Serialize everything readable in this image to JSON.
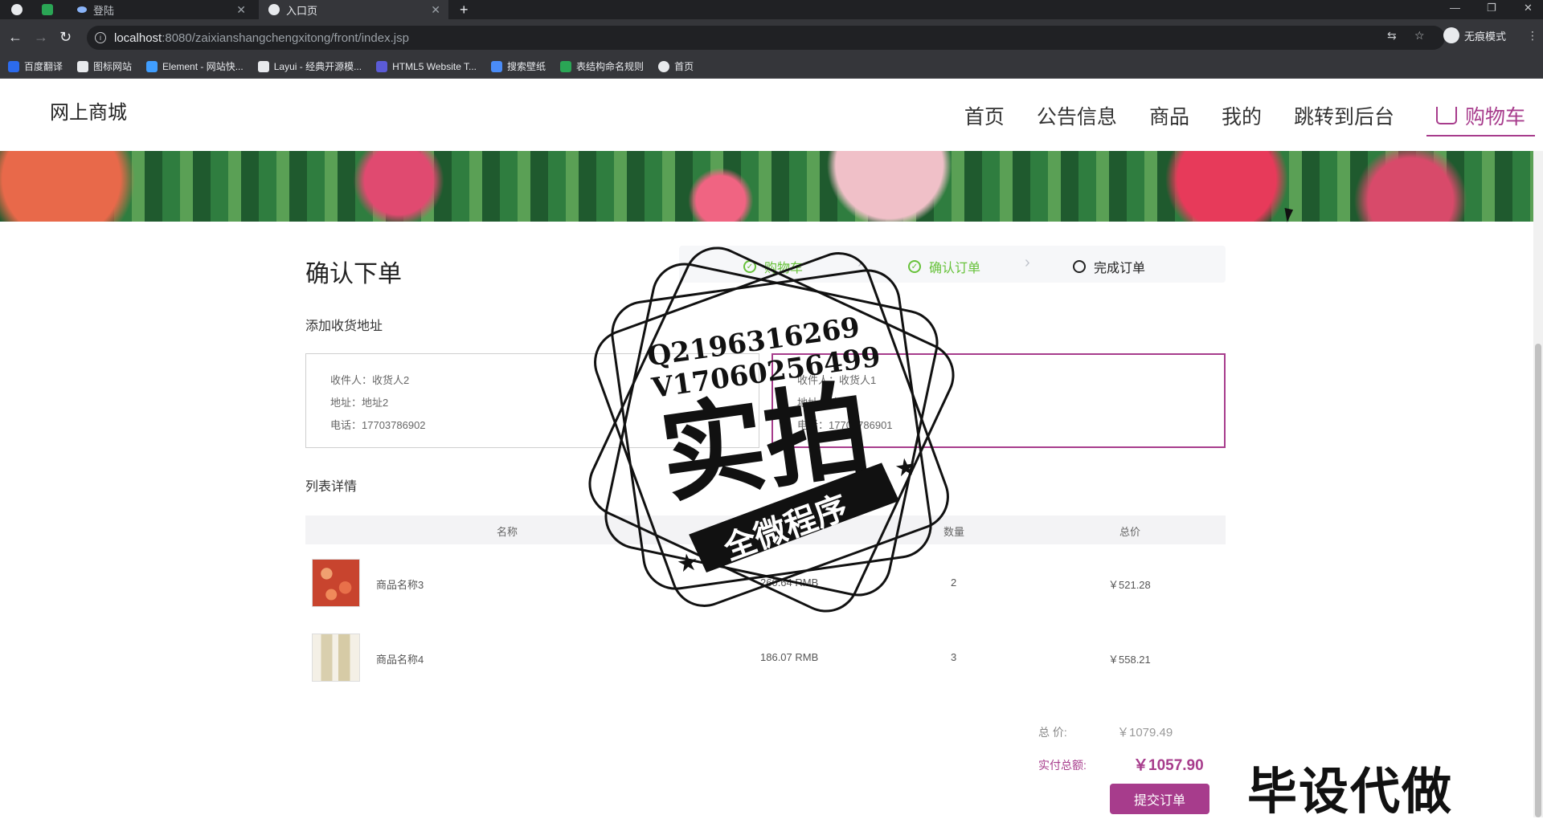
{
  "browser": {
    "tabs": [
      {
        "label": "",
        "active": false
      },
      {
        "label": "",
        "active": false
      },
      {
        "label": "登陆",
        "active": false
      },
      {
        "label": "入口页",
        "active": true
      }
    ],
    "url_host": "localhost",
    "url_rest": ":8080/zaixianshangchengxitong/front/index.jsp",
    "incognito": "无痕模式",
    "bookmarks": [
      {
        "label": "百度翻译",
        "color": "#2c6bed"
      },
      {
        "label": "图标网站",
        "color": "#e8eaed"
      },
      {
        "label": "Element - 网站快...",
        "color": "#409eff"
      },
      {
        "label": "Layui - 经典开源模...",
        "color": "#e8eaed"
      },
      {
        "label": "HTML5 Website T...",
        "color": "#5b5bd6"
      },
      {
        "label": "搜索壁纸",
        "color": "#4a8cf7"
      },
      {
        "label": "表结构命名规则",
        "color": "#2aa655"
      },
      {
        "label": "首页",
        "color": "#e8eaed"
      }
    ]
  },
  "site": {
    "logo": "网上商城",
    "nav": [
      "首页",
      "公告信息",
      "商品",
      "我的",
      "跳转到后台"
    ],
    "cart": "购物车",
    "accent": "#a73c8c"
  },
  "order": {
    "title": "确认下单",
    "steps": [
      "购物车",
      "确认订单",
      "完成订单"
    ],
    "address_section": "添加收货地址",
    "addresses": [
      {
        "receiver": "收件人：收货人2",
        "address": "地址：地址2",
        "phone": "电话：17703786902"
      },
      {
        "receiver": "收件人：收货人1",
        "address": "地址：地址1",
        "phone": "电话：17703786901"
      }
    ],
    "list_section": "列表详情",
    "columns": [
      "名称",
      "单价",
      "数量",
      "总价"
    ],
    "items": [
      {
        "name": "商品名称3",
        "price": "260.64 RMB",
        "qty": "2",
        "total": "￥521.28"
      },
      {
        "name": "商品名称4",
        "price": "186.07 RMB",
        "qty": "3",
        "total": "￥558.21"
      }
    ],
    "total_label": "总    价:",
    "total_value": "￥1079.49",
    "pay_label": "实付总额:",
    "pay_value": "￥1057.90",
    "submit": "提交订单"
  },
  "watermark": {
    "qq": "Q2196316269",
    "vx": "V17060256499",
    "big": "实拍",
    "ribbon": "全微程序",
    "ad": "毕设代做"
  }
}
